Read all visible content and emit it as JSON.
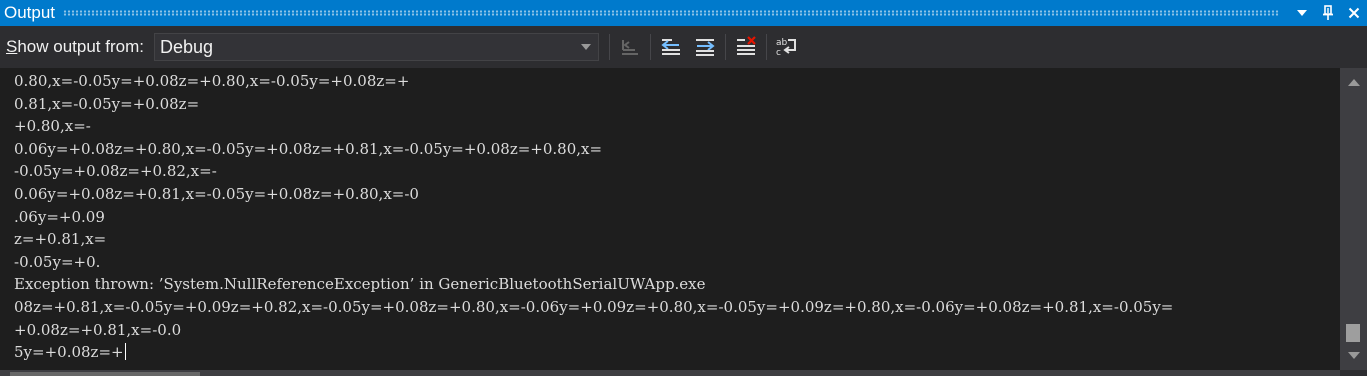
{
  "titlebar": {
    "title": "Output"
  },
  "toolbar": {
    "show_output_prefix": "S",
    "show_output_rest": "how output from:",
    "source_selected": "Debug",
    "buttons": [
      "find-message-in-code-icon",
      "go-to-previous-message-icon",
      "go-to-next-message-icon",
      "clear-all-icon",
      "toggle-word-wrap-icon"
    ]
  },
  "output": {
    "lines": [
      "0.80,x=-0.05y=+0.08z=+0.80,x=-0.05y=+0.08z=+",
      "0.81,x=-0.05y=+0.08z=",
      "+0.80,x=-",
      "0.06y=+0.08z=+0.80,x=-0.05y=+0.08z=+0.81,x=-0.05y=+0.08z=+0.80,x=",
      "-0.05y=+0.08z=+0.82,x=-",
      "0.06y=+0.08z=+0.81,x=-0.05y=+0.08z=+0.80,x=-0",
      ".06y=+0.09",
      "z=+0.81,x=",
      "-0.05y=+0.",
      "Exception thrown: ’System.NullReferenceException’ in GenericBluetoothSerialUWApp.exe",
      "08z=+0.81,x=-0.05y=+0.09z=+0.82,x=-0.05y=+0.08z=+0.80,x=-0.06y=+0.09z=+0.80,x=-0.05y=+0.09z=+0.80,x=-0.06y=+0.08z=+0.81,x=-0.05y=",
      "+0.08z=+0.81,x=-0.0",
      "5y=+0.08z=+"
    ]
  },
  "colors": {
    "titlebar_bg": "#007acc",
    "toolbar_bg": "#2d2d30",
    "output_bg": "#1e1e1e",
    "text": "#dcdcdc",
    "icon_blue": "#75beff"
  }
}
